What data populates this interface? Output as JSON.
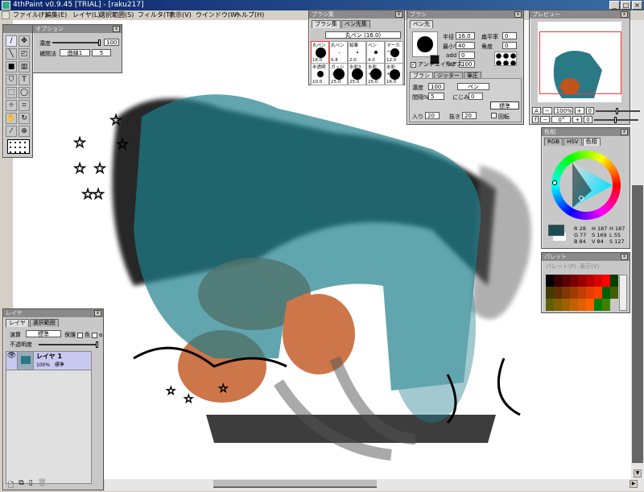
{
  "window": {
    "title": "4thPaint v0.9.45 [TRIAL] - [raku217]",
    "buttons": [
      "_",
      "□",
      "×"
    ]
  },
  "menu": [
    "ファイル(F)",
    "編集(E)",
    "レイヤ(L)",
    "選択範囲(S)",
    "フィルタ(T)",
    "表示(V)",
    "ウインドウ(W)",
    "ヘルプ(H)"
  ],
  "option_panel": {
    "title": "オプション",
    "density_label": "濃度",
    "density_value": "100",
    "density_fraction": 1.0,
    "interp_label": "補間法",
    "interp_value": "曲線1",
    "interp_num": "5"
  },
  "brushset_panel": {
    "title": "ブラシ集",
    "tabs": [
      "ブラシ集",
      "ペン先集"
    ],
    "current": "丸ペン (16.0)",
    "brushes": [
      {
        "name": "丸ペン",
        "size": "16.0"
      },
      {
        "name": "丸ペン",
        "size": "0.8"
      },
      {
        "name": "鉛筆",
        "size": "2.0"
      },
      {
        "name": "ペン",
        "size": "4.0"
      },
      {
        "name": "マーカー",
        "size": "12.0"
      },
      {
        "name": "半透明",
        "size": "10.0"
      },
      {
        "name": "ガッシュ",
        "size": "25.0"
      },
      {
        "name": "水彩3",
        "size": "25.0"
      },
      {
        "name": "水彩+に",
        "size": "25.0"
      },
      {
        "name": "水彩+手",
        "size": "16.0"
      }
    ]
  },
  "brush_panel": {
    "title": "ブラシ",
    "tip_tab": "ペン先",
    "radius_label": "半径",
    "radius": "16.0",
    "min_label": "最小%",
    "min": "40",
    "flat_label": "扁平率",
    "flat": "0",
    "angle_label": "角度",
    "angle": "0",
    "add_label": "add",
    "add": "0",
    "flat2_label": "flat",
    "flat2": "100",
    "antialias_label": "アンチエイリアス",
    "antialias": true,
    "tabs": [
      "ブラシ",
      "ジッター",
      "筆圧"
    ],
    "density_label": "濃度",
    "density": "100",
    "pen_name": "ペン",
    "interval_label": "間隔%",
    "interval": "5",
    "blur_label": "にじみ",
    "blur": "0",
    "standard_button": "標準",
    "in_label": "入り",
    "in": "20",
    "out_label": "抜き",
    "out": "20",
    "rotate_label": "回転",
    "rotate": false
  },
  "preview_panel": {
    "title": "プレビュー",
    "zoom": "100%",
    "angle": "0°",
    "zoom_btn": "A",
    "angle_btn": "f",
    "minus": "−",
    "plus": "+",
    "reset": "0"
  },
  "color_panel": {
    "title": "色相",
    "tabs": [
      "RGB",
      "HSV",
      "色相"
    ],
    "current_color": "#1c4d54",
    "values": [
      [
        "R",
        "28"
      ],
      [
        "G",
        "77"
      ],
      [
        "B",
        "84"
      ],
      [
        "H",
        "187"
      ],
      [
        "S",
        "169"
      ],
      [
        "V",
        "84"
      ],
      [
        "H",
        "187"
      ],
      [
        "L",
        "55"
      ],
      [
        "S",
        "127"
      ]
    ]
  },
  "palette_panel": {
    "title": "パレット",
    "menu": [
      "パレット(P)",
      "表示(V)"
    ],
    "colors": [
      "#000000",
      "#3a0000",
      "#5a0000",
      "#780000",
      "#980000",
      "#b80000",
      "#d80000",
      "#ff0000",
      "#004000",
      "#403c00",
      "#603000",
      "#803800",
      "#a03c00",
      "#c04000",
      "#e04000",
      "#ff4000",
      "#006000",
      "#406000",
      "#606000",
      "#806000",
      "#a06000",
      "#c06000",
      "#e06000",
      "#ff6000",
      "#008000",
      "#408000"
    ]
  },
  "layer_panel": {
    "title": "レイヤ",
    "tabs": [
      "レイヤ",
      "選択範囲"
    ],
    "blend_label": "演算",
    "blend": "標準",
    "protect_label": "保護",
    "color_label": "色",
    "alpha_label": "α",
    "opacity_label": "不透明度",
    "opacity_fraction": 1.0,
    "layers": [
      {
        "name": "レイヤ 1",
        "opacity": "100%",
        "mode": "標準"
      }
    ]
  },
  "tools": [
    "brush",
    "move",
    "line",
    "rect-select-shape",
    "fill",
    "gradient",
    "stamp",
    "text",
    "rect-select",
    "lasso",
    "magic-wand",
    "crop",
    "hand",
    "rotate",
    "eyedropper",
    "zoom"
  ]
}
